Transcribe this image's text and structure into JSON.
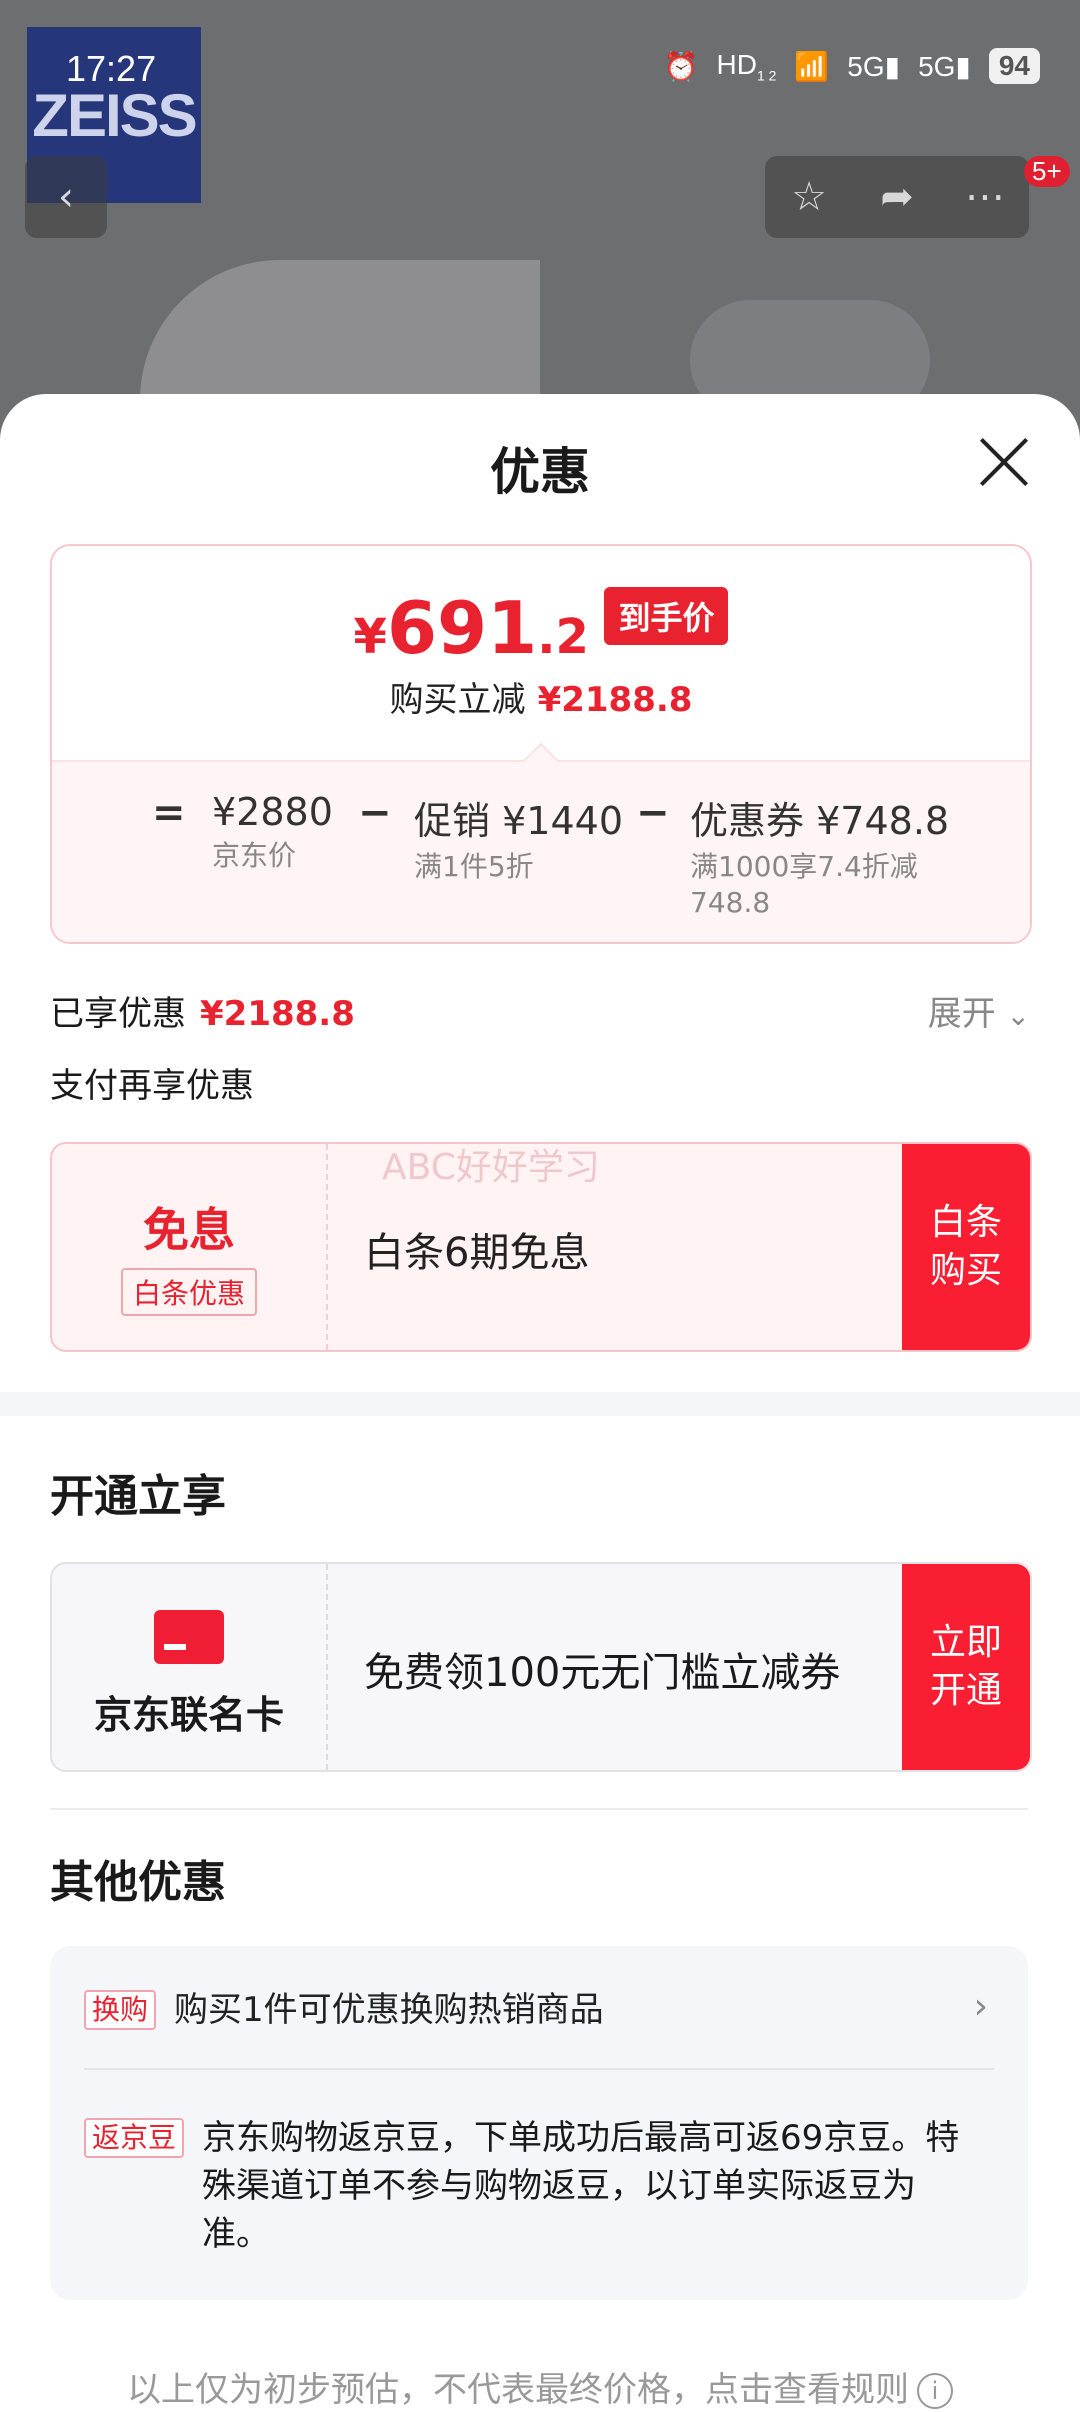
{
  "status_bar": {
    "time": "17:27",
    "hd_label": "HD",
    "hd_sub": "1 2",
    "network_1": "5G",
    "network_2": "5G",
    "battery": "94"
  },
  "top": {
    "brand_logo_text": "ZEISS",
    "notification_badge": "5+"
  },
  "sheet": {
    "title": "优惠",
    "price": {
      "currency": "¥",
      "integer": "691",
      "decimal": ".2",
      "final_tag": "到手价",
      "reduce_label": "购买立减",
      "reduce_value": "¥2188.8"
    },
    "breakdown": {
      "eq": "=",
      "minus": "−",
      "jd_price": "¥2880",
      "jd_price_label": "京东价",
      "promo_label": "促销",
      "promo_value": "¥1440",
      "promo_desc": "满1件5折",
      "coupon_label": "优惠券",
      "coupon_value": "¥748.8",
      "coupon_desc_1": "满1000享7.4折减",
      "coupon_desc_2": "748.8"
    },
    "enjoyed_label": "已享优惠",
    "enjoyed_value": "¥2188.8",
    "expand_label": "展开",
    "pay_more_label": "支付再享优惠",
    "baitiao": {
      "free_label": "免息",
      "tag": "白条优惠",
      "text": "白条6期免息",
      "watermark": "ABC好好学习",
      "button_line1": "白条",
      "button_line2": "购买"
    },
    "open_section": {
      "title": "开通立享",
      "card_name": "京东联名卡",
      "text": "免费领100元无门槛立减券",
      "button_line1": "立即",
      "button_line2": "开通"
    },
    "other_section": {
      "title": "其他优惠",
      "items": [
        {
          "tag": "换购",
          "text": "购买1件可优惠换购热销商品"
        },
        {
          "tag": "返京豆",
          "text": "京东购物返京豆，下单成功后最高可返69京豆。特殊渠道订单不参与购物返豆，以订单实际返豆为准。"
        }
      ]
    },
    "footer": "以上仅为初步预估，不代表最终价格，点击查看规则"
  },
  "colors": {
    "accent": "#e8232f",
    "button_red": "#fa1e32"
  },
  "icons": [
    "back-icon",
    "star-icon",
    "share-icon",
    "more-icon",
    "close-icon",
    "chevron-down-icon",
    "chevron-right-icon",
    "info-icon",
    "card-icon"
  ]
}
